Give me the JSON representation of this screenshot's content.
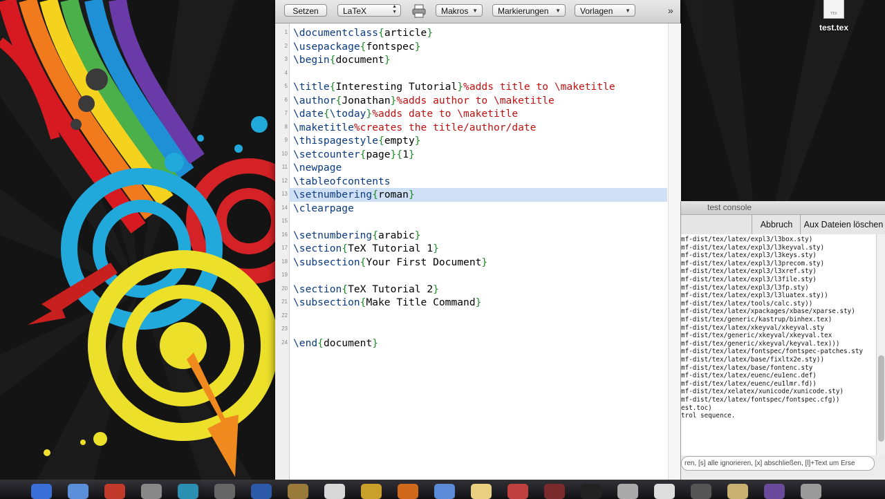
{
  "toolbar": {
    "typeset_label": "Setzen",
    "format_select": "LaTeX",
    "macros_label": "Makros",
    "tags_label": "Markierungen",
    "templates_label": "Vorlagen"
  },
  "editor": {
    "selected_line": 13,
    "lines": [
      {
        "n": "1",
        "segs": [
          {
            "t": "\\documentclass",
            "c": "cmd"
          },
          {
            "t": "{",
            "c": "br"
          },
          {
            "t": "article",
            "c": ""
          },
          {
            "t": "}",
            "c": "br"
          }
        ]
      },
      {
        "n": "2",
        "segs": [
          {
            "t": "\\usepackage",
            "c": "cmd"
          },
          {
            "t": "{",
            "c": "br"
          },
          {
            "t": "fontspec",
            "c": ""
          },
          {
            "t": "}",
            "c": "br"
          }
        ]
      },
      {
        "n": "3",
        "segs": [
          {
            "t": "\\begin",
            "c": "cmd"
          },
          {
            "t": "{",
            "c": "br"
          },
          {
            "t": "document",
            "c": ""
          },
          {
            "t": "}",
            "c": "br"
          }
        ]
      },
      {
        "n": "4",
        "segs": []
      },
      {
        "n": "5",
        "segs": [
          {
            "t": "\\title",
            "c": "cmd"
          },
          {
            "t": "{",
            "c": "br"
          },
          {
            "t": "Interesting Tutorial",
            "c": ""
          },
          {
            "t": "}",
            "c": "br"
          },
          {
            "t": "%adds title to \\maketitle",
            "c": "cm"
          }
        ]
      },
      {
        "n": "6",
        "segs": [
          {
            "t": "\\author",
            "c": "cmd"
          },
          {
            "t": "{",
            "c": "br"
          },
          {
            "t": "Jonathan",
            "c": ""
          },
          {
            "t": "}",
            "c": "br"
          },
          {
            "t": "%adds author to \\maketitle",
            "c": "cm"
          }
        ]
      },
      {
        "n": "7",
        "segs": [
          {
            "t": "\\date",
            "c": "cmd"
          },
          {
            "t": "{",
            "c": "br"
          },
          {
            "t": "\\today",
            "c": "cmd"
          },
          {
            "t": "}",
            "c": "br"
          },
          {
            "t": "%adds date to \\maketitle",
            "c": "cm"
          }
        ]
      },
      {
        "n": "8",
        "segs": [
          {
            "t": "\\maketitle",
            "c": "cmd"
          },
          {
            "t": "%creates the title/author/date",
            "c": "cm"
          }
        ]
      },
      {
        "n": "9",
        "segs": [
          {
            "t": "\\thispagestyle",
            "c": "cmd"
          },
          {
            "t": "{",
            "c": "br"
          },
          {
            "t": "empty",
            "c": ""
          },
          {
            "t": "}",
            "c": "br"
          }
        ]
      },
      {
        "n": "10",
        "segs": [
          {
            "t": "\\setcounter",
            "c": "cmd"
          },
          {
            "t": "{",
            "c": "br"
          },
          {
            "t": "page",
            "c": ""
          },
          {
            "t": "}{",
            "c": "br"
          },
          {
            "t": "1",
            "c": ""
          },
          {
            "t": "}",
            "c": "br"
          }
        ]
      },
      {
        "n": "11",
        "segs": [
          {
            "t": "\\newpage",
            "c": "cmd"
          }
        ]
      },
      {
        "n": "12",
        "segs": [
          {
            "t": "\\tableofcontents",
            "c": "cmd"
          }
        ]
      },
      {
        "n": "13",
        "segs": [
          {
            "t": "\\setnumbering",
            "c": "cmd"
          },
          {
            "t": "{",
            "c": "br"
          },
          {
            "t": "roman",
            "c": ""
          },
          {
            "t": "}",
            "c": "br"
          }
        ]
      },
      {
        "n": "14",
        "segs": [
          {
            "t": "\\clearpage",
            "c": "cmd"
          }
        ]
      },
      {
        "n": "15",
        "segs": []
      },
      {
        "n": "16",
        "segs": [
          {
            "t": "\\setnumbering",
            "c": "cmd"
          },
          {
            "t": "{",
            "c": "br"
          },
          {
            "t": "arabic",
            "c": ""
          },
          {
            "t": "}",
            "c": "br"
          }
        ]
      },
      {
        "n": "17",
        "segs": [
          {
            "t": "\\section",
            "c": "cmd"
          },
          {
            "t": "{",
            "c": "br"
          },
          {
            "t": "TeX Tutorial 1",
            "c": ""
          },
          {
            "t": "}",
            "c": "br"
          }
        ]
      },
      {
        "n": "18",
        "segs": [
          {
            "t": "\\subsection",
            "c": "cmd"
          },
          {
            "t": "{",
            "c": "br"
          },
          {
            "t": "Your First Document",
            "c": ""
          },
          {
            "t": "}",
            "c": "br"
          }
        ]
      },
      {
        "n": "19",
        "segs": []
      },
      {
        "n": "20",
        "segs": [
          {
            "t": "\\section",
            "c": "cmd"
          },
          {
            "t": "{",
            "c": "br"
          },
          {
            "t": "TeX Tutorial 2",
            "c": ""
          },
          {
            "t": "}",
            "c": "br"
          }
        ]
      },
      {
        "n": "21",
        "segs": [
          {
            "t": "\\subsection",
            "c": "cmd"
          },
          {
            "t": "{",
            "c": "br"
          },
          {
            "t": "Make Title Command",
            "c": ""
          },
          {
            "t": "}",
            "c": "br"
          }
        ]
      },
      {
        "n": "22",
        "segs": []
      },
      {
        "n": "23",
        "segs": []
      },
      {
        "n": "24",
        "segs": [
          {
            "t": "\\end",
            "c": "cmd"
          },
          {
            "t": "{",
            "c": "br"
          },
          {
            "t": "document",
            "c": ""
          },
          {
            "t": "}",
            "c": "br"
          }
        ]
      }
    ]
  },
  "console": {
    "title": "test console",
    "abort_label": "Abbruch",
    "delete_aux_label": "Aux Dateien löschen",
    "log_lines": [
      "mf-dist/tex/latex/expl3/l3box.sty)",
      "mf-dist/tex/latex/expl3/l3keyval.sty)",
      "mf-dist/tex/latex/expl3/l3keys.sty)",
      "mf-dist/tex/latex/expl3/l3precom.sty)",
      "mf-dist/tex/latex/expl3/l3xref.sty)",
      "mf-dist/tex/latex/expl3/l3file.sty)",
      "mf-dist/tex/latex/expl3/l3fp.sty)",
      "mf-dist/tex/latex/expl3/l3luatex.sty))",
      "mf-dist/tex/latex/tools/calc.sty))",
      "mf-dist/tex/latex/xpackages/xbase/xparse.sty)",
      "mf-dist/tex/generic/kastrup/binhex.tex)",
      "mf-dist/tex/latex/xkeyval/xkeyval.sty",
      "mf-dist/tex/generic/xkeyval/xkeyval.tex",
      "mf-dist/tex/generic/xkeyval/keyval.tex)))",
      "mf-dist/tex/latex/fontspec/fontspec-patches.sty",
      "mf-dist/tex/latex/base/fixltx2e.sty))",
      "mf-dist/tex/latex/base/fontenc.sty",
      "mf-dist/tex/latex/euenc/eu1enc.def)",
      "mf-dist/tex/latex/euenc/eu1lmr.fd))",
      "mf-dist/tex/xelatex/xunicode/xunicode.sty)",
      "mf-dist/tex/latex/fontspec/fontspec.cfg))",
      "est.toc)",
      "trol sequence."
    ],
    "input_hint": "ren, [s] alle ignorieren, [x] abschließen, [l]+Text um Erse"
  },
  "desktop": {
    "file_name": "test.tex",
    "file_badge": "TEX"
  },
  "dock": {
    "icons": [
      "finder-icon",
      "folder-icon",
      "safari-icon",
      "system-icon",
      "preview-icon",
      "dock-separator-icon",
      "word-icon",
      "tv-icon",
      "app-icon",
      "calendar-icon",
      "firefox-icon",
      "mail-icon",
      "notes-icon",
      "ical-icon",
      "texshop-icon",
      "terminal-icon",
      "tools-icon",
      "script-icon",
      "console-icon",
      "archive-icon",
      "user-icon",
      "trash-icon"
    ]
  }
}
